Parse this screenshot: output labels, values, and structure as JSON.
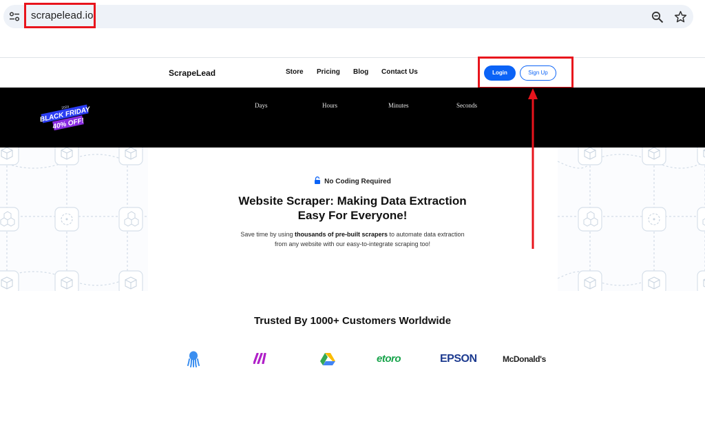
{
  "browser": {
    "url": "scrapelead.io",
    "icons": [
      "site-settings-icon",
      "zoom-icon",
      "bookmark-star-icon"
    ]
  },
  "nav": {
    "logo": "ScrapeLead",
    "links": [
      "Store",
      "Pricing",
      "Blog",
      "Contact Us"
    ],
    "login_label": "Login",
    "signup_label": "Sign Up"
  },
  "banner": {
    "badge_year": "2024",
    "badge_line1": "BLACK FRIDAY",
    "badge_line2": "40% OFF!",
    "countdown": [
      "Days",
      "Hours",
      "Minutes",
      "Seconds"
    ]
  },
  "hero": {
    "pill": "No Coding Required",
    "title_line1": "Website Scraper: Making Data Extraction",
    "title_line2": "Easy For Everyone!",
    "sub_pre": "Save time by using ",
    "sub_bold": "thousands of pre-built scrapers",
    "sub_post": " to automate data extraction",
    "sub_line2": "from any website with our easy-to-integrate scraping too!"
  },
  "trusted": {
    "heading": "Trusted By 1000+ Customers Worldwide",
    "brands": [
      "octopus-logo",
      "make-logo",
      "google-drive-logo",
      "etoro",
      "EPSON",
      "McDonald's"
    ],
    "etoro_text": "etoro",
    "epson_text": "EPSON",
    "mcd_text": "McDonald's"
  },
  "colors": {
    "accent": "#0b63f6",
    "annotation": "#e8141c",
    "banner_bg": "#000000"
  }
}
